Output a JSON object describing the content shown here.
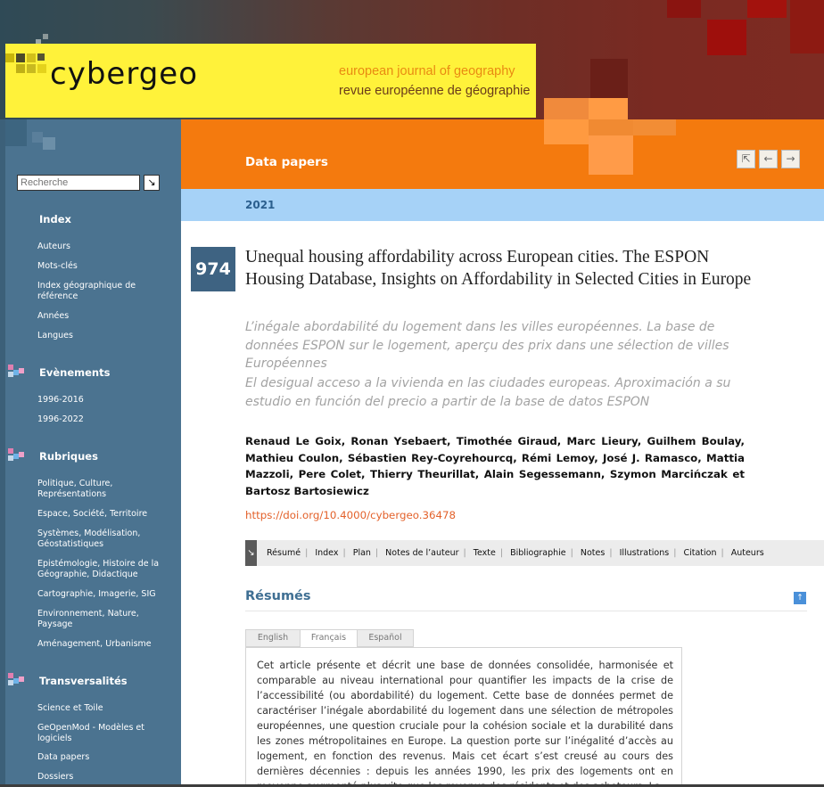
{
  "brand": {
    "logo": "cybergeo",
    "tagline_en": "european journal of geography",
    "tagline_fr": "revue européenne de géographie"
  },
  "colors": {
    "header_orange": "#f47a0e",
    "logo_yellow": "#fff23a",
    "sidebar_blue": "#4b7390",
    "year_bar": "#a6d2f7",
    "doi_link": "#e3612a"
  },
  "sidebar": {
    "search": {
      "placeholder": "Recherche",
      "button_icon": "arrow-down-right-icon"
    },
    "sections": [
      {
        "heading": "Index",
        "items": [
          "Auteurs",
          "Mots-clés",
          "Index géographique de référence",
          "Années",
          "Langues"
        ]
      },
      {
        "heading": "Evènements",
        "items": [
          "1996-2016",
          "1996-2022"
        ]
      },
      {
        "heading": "Rubriques",
        "items": [
          "Politique, Culture, Représentations",
          "Espace, Société, Territoire",
          "Systèmes, Modélisation, Géostatistiques",
          "Epistémologie, Histoire de la Géographie, Didactique",
          "Cartographie, Imagerie, SIG",
          "Environnement, Nature, Paysage",
          "Aménagement, Urbanisme"
        ]
      },
      {
        "heading": "Transversalités",
        "items": [
          "Science et Toile",
          "GeOpenMod - Modèles et logiciels",
          "Data papers",
          "Dossiers"
        ]
      }
    ]
  },
  "main": {
    "section_title": "Data papers",
    "nav": {
      "up_icon": "arrow-up-left-icon",
      "prev_icon": "arrow-left-icon",
      "next_icon": "arrow-right-icon"
    },
    "year": "2021",
    "issue_number": "974",
    "title": "Unequal housing affordability across European cities. The ESPON Housing Database, Insights on Affordability in Selected Cities in Europe",
    "title_fr": "L’inégale abordabilité du logement dans les villes européennes. La base de données ESPON sur le logement, aperçu des prix dans une sélection de villes Européennes",
    "title_es": "El desigual acceso a la vivienda en las ciudades europeas. Aproximación a su estudio en función del precio a partir de la base de datos ESPON",
    "authors": "Renaud Le Goix, Ronan Ysebaert, Timothée Giraud, Marc Lieury, Guilhem Boulay, Mathieu Coulon, Sébastien Rey-Coyrehourcq, Rémi Lemoy, José J. Ramasco, Mattia Mazzoli, Pere Colet, Thierry Theurillat, Alain Segessemann, Szymon Marcińczak et Bartosz Bartosiewicz",
    "doi": "https://doi.org/10.4000/cybergeo.36478",
    "toc": [
      "Résumé",
      "Index",
      "Plan",
      "Notes de l’auteur",
      "Texte",
      "Bibliographie",
      "Notes",
      "Illustrations",
      "Citation",
      "Auteurs"
    ],
    "resumes_heading": "Résumés",
    "lang_tabs": [
      {
        "label": "English",
        "active": false
      },
      {
        "label": "Français",
        "active": true
      },
      {
        "label": "Español",
        "active": false
      }
    ],
    "abstract": "Cet article présente et décrit une base de données consolidée, harmonisée et comparable au niveau international pour quantifier les impacts de la crise de l’accessibilité (ou abordabilité) du logement. Cette base de données permet de caractériser l’inégale abordabilité du logement dans une sélection de métropoles européennes, une question cruciale pour la cohésion sociale et la durabilité dans les zones métropolitaines en Europe. La question porte sur l’inégalité d’accès au logement, en fonction des revenus. Mais cet écart s’est creusé au cours des dernières décennies : depuis les années 1990, les prix des logements ont en moyenne augmenté plus vite que les revenus des résidents et des acheteurs. La"
  }
}
